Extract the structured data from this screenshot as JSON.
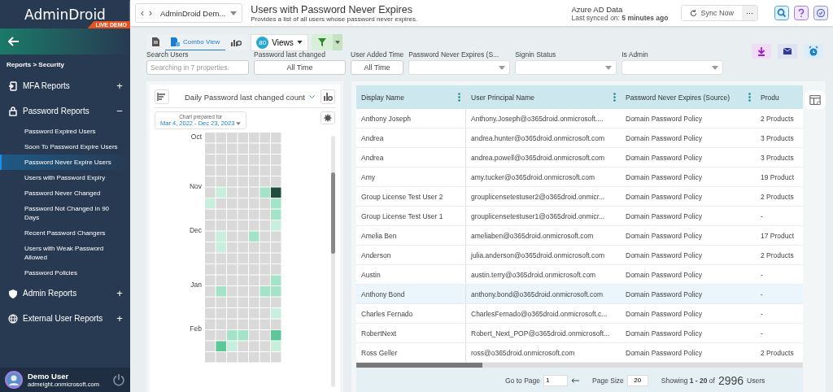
{
  "sidebar": {
    "logo": "AdminDroid",
    "badge": "LIVE DEMO",
    "breadcrumb": "Reports > Security",
    "sections": [
      {
        "kind": "mfa",
        "label": "MFA Reports",
        "toggle": "+"
      },
      {
        "kind": "lock",
        "label": "Password Reports",
        "toggle": "−",
        "children": [
          {
            "label": "Password Expired Users",
            "selected": false
          },
          {
            "label": "Soon To Password Expire Users",
            "selected": false
          },
          {
            "label": "Password Never Expire Users",
            "selected": true
          },
          {
            "label": "Users with Password Expiry",
            "selected": false
          },
          {
            "label": "Password Never Changed",
            "selected": false
          },
          {
            "label": "Password Not Changed in 90 Days",
            "selected": false
          },
          {
            "label": "Recent Password Changers",
            "selected": false
          },
          {
            "label": "Users with Weak Password Allowed",
            "selected": false
          },
          {
            "label": "Password Policies",
            "selected": false
          }
        ]
      },
      {
        "kind": "shield",
        "label": "Admin Reports",
        "toggle": "+"
      },
      {
        "kind": "globe",
        "label": "External User Reports",
        "toggle": "+"
      }
    ],
    "user": {
      "name": "Demo User",
      "email": "admeight.onmicrosoft.com"
    }
  },
  "header": {
    "back": "‹",
    "forward": "›",
    "org": "AdminDroid Dem...",
    "title": "Users with Password Never Expires",
    "subtitle": "Provides a list of all users whose password never expires.",
    "source_title": "Azure AD Data",
    "sync_text": "Last synced on: **5 minutes ago**",
    "sync_button": "Sync Now",
    "more": "···"
  },
  "toolbar": {
    "tabs": [
      {
        "kind": "report",
        "selected": false
      },
      {
        "kind": "combo",
        "label": "Combo View",
        "selected": true
      },
      {
        "kind": "chart",
        "selected": false
      }
    ],
    "views_badge": "80",
    "views": "Views"
  },
  "filters": [
    {
      "kind": "search",
      "label": "Search Users",
      "placeholder": "Searching in 7 properties."
    },
    {
      "kind": "button",
      "label": "Password last changed",
      "value": "All Time"
    },
    {
      "kind": "button",
      "label": "User Added Time",
      "value": "All Time"
    },
    {
      "kind": "select",
      "label": "Password Never Expires (S..."
    },
    {
      "kind": "select",
      "label": "Signin Status"
    },
    {
      "kind": "select",
      "label": "Is Admin"
    }
  ],
  "chart_panel": {
    "title": "Daily Password last changed count",
    "prepared_label": "Chart prepared for",
    "range": "Mar 4, 2022 - Dec 23, 2023",
    "months": [
      "Oct",
      "Nov",
      "Dec",
      "Jan",
      "Feb"
    ]
  },
  "table": {
    "columns": [
      "Display Name",
      "User Principal Name",
      "Password Never Expires (Source)",
      "Produ"
    ],
    "rows": [
      {
        "cells": [
          "Anthony Joseph",
          "Anthony.Joseph@o365droid.onmicrosoft....",
          "Domain Password Policy",
          "2 Products"
        ],
        "selected": false
      },
      {
        "cells": [
          "Andrea",
          "andrea.hunter@o365droid.onmicrosoft.com",
          "Domain Password Policy",
          "3 Products"
        ],
        "selected": false
      },
      {
        "cells": [
          "Andrea",
          "andrea.powell@o365droid.onmicrosoft.com",
          "Domain Password Policy",
          "3 Products"
        ],
        "selected": false
      },
      {
        "cells": [
          "Amy",
          "amy.tucker@o365droid.onmicrosoft.com",
          "Domain Password Policy",
          "19 Product"
        ],
        "selected": false
      },
      {
        "cells": [
          "Group License Test User 2",
          "grouplicensetestuser2@o365droid.onmicr...",
          "Domain Password Policy",
          "2 Products"
        ],
        "selected": false
      },
      {
        "cells": [
          "Group License Test User 1",
          "grouplicensetestuser1@o365droid.onmicr...",
          "Domain Password Policy",
          "-"
        ],
        "selected": false
      },
      {
        "cells": [
          "Amelia Ben",
          "ameliaben@o365droid.onmicrosoft.com",
          "Domain Password Policy",
          "17 Product"
        ],
        "selected": false
      },
      {
        "cells": [
          "Anderson",
          "julia.anderson@o365droid.onmicrosoft.com",
          "Domain Password Policy",
          "2 Products"
        ],
        "selected": false
      },
      {
        "cells": [
          "Austin",
          "austin.terry@o365droid.onmicrosoft.com",
          "Domain Password Policy",
          "-"
        ],
        "selected": false
      },
      {
        "cells": [
          "Anthony Bond",
          "anthony.bond@o365droid.onmicrosoft.com",
          "Domain Password Policy",
          "-"
        ],
        "selected": true
      },
      {
        "cells": [
          "Charles Fernado",
          "CharlesFernado@o365droid.onmicrosoft.c...",
          "Domain Password Policy",
          "-"
        ],
        "selected": false
      },
      {
        "cells": [
          "RobertNext",
          "Robert_Next_POP@o365droid.onmicrosoft...",
          "Domain Password Policy",
          "-"
        ],
        "selected": false
      },
      {
        "cells": [
          "Ross Geller",
          "ross@o365droid.onmicrosoft.com",
          "Domain Password Policy",
          "2 Products"
        ],
        "selected": false
      }
    ]
  },
  "footer": {
    "go_to_page": "Go to Page",
    "page": "1",
    "page_size_label": "Page Size",
    "page_size": "20",
    "showing": "Showing **1 - 20** of",
    "total": "2996",
    "unit": "Users"
  }
}
